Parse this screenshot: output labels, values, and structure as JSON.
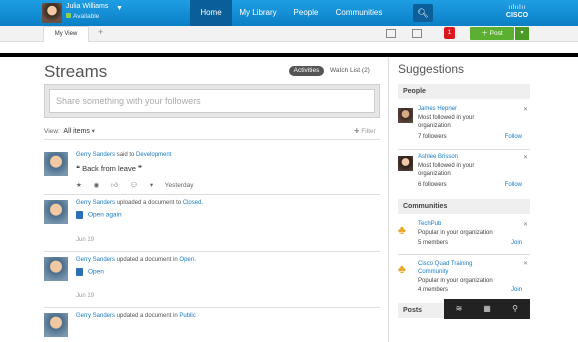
{
  "user": {
    "name": "Julia Williams",
    "status": "Available"
  },
  "nav": {
    "items": [
      "Home",
      "My Library",
      "People",
      "Communities"
    ],
    "active": "Home"
  },
  "brand": {
    "logo_text": "CISCO"
  },
  "tabs": {
    "current": "My View",
    "add": "+"
  },
  "toolbar": {
    "notification_count": "1",
    "post_label": "Post"
  },
  "main": {
    "title": "Streams",
    "filters": {
      "activities": "Activities",
      "watch_list": "Watch List (2)"
    },
    "share_placeholder": "Share something with your followers",
    "view_label": "View:",
    "view_value": "All items",
    "filter_label": "Filter"
  },
  "stream": [
    {
      "author": "Gerry Sanders",
      "verb": "said to",
      "target": "Development",
      "quote": "Back from leave",
      "time": "Yesterday"
    },
    {
      "author": "Gerry Sanders",
      "verb": "uploaded a document to",
      "target": "Closed.",
      "doc": "Open again",
      "date": "Jun 19"
    },
    {
      "author": "Gerry Sanders",
      "verb": "updated a document in",
      "target": "Open.",
      "doc": "Open",
      "date": "Jun 19"
    },
    {
      "author": "Gerry Sanders",
      "verb": "updated a document in",
      "target": "Public"
    }
  ],
  "suggestions": {
    "title": "Suggestions",
    "people_header": "People",
    "people": [
      {
        "name": "James Hepner",
        "desc": "Most followed in your organization",
        "count": "7 followers",
        "action": "Follow"
      },
      {
        "name": "Ashlee Brisson",
        "desc": "Most followed in your organization",
        "count": "6 followers",
        "action": "Follow"
      }
    ],
    "communities_header": "Communities",
    "communities": [
      {
        "name": "TechPub",
        "desc": "Popular in your organization",
        "count": "5 members",
        "action": "Join"
      },
      {
        "name": "Cisco Quad Training Community",
        "desc": "Popular in your organization",
        "count": "4 members",
        "action": "Join"
      }
    ],
    "posts_header": "Posts"
  },
  "colors": {
    "topbar": "#1f9ee3",
    "link": "#1a7bc5",
    "post_button": "#5cb031",
    "badge": "#d9181f"
  }
}
